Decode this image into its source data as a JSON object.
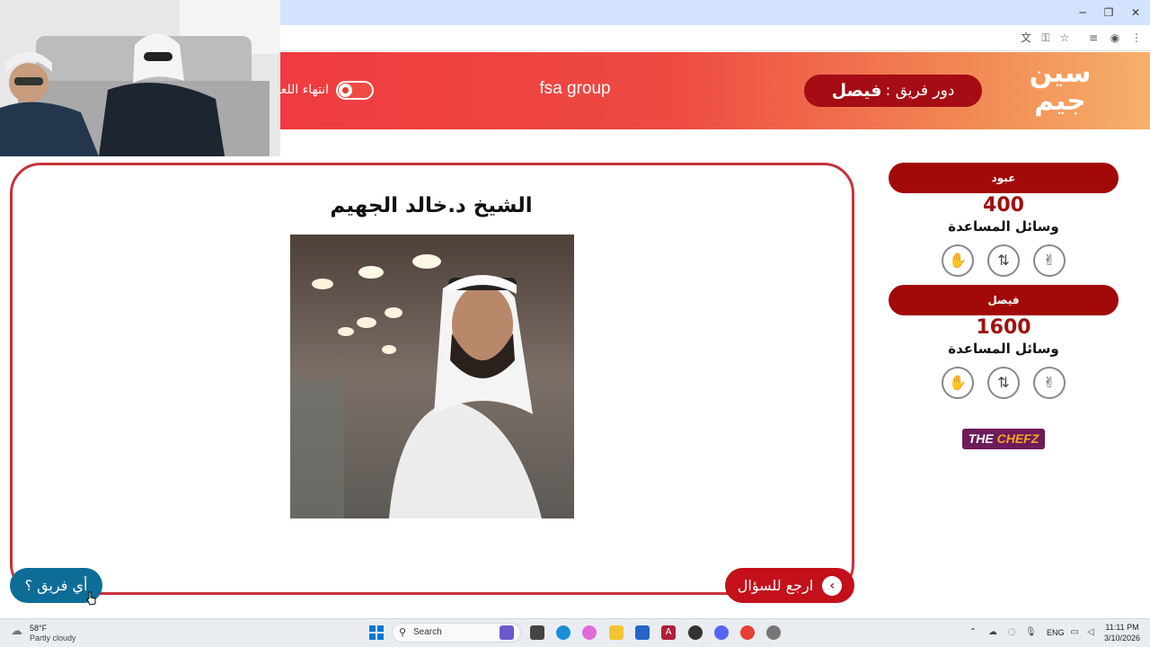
{
  "header": {
    "team_name": "fsa group",
    "turn_label": "دور فريق :",
    "turn_team": "فيصل",
    "end_label": "انتهاء اللعبة",
    "logo_line1": "سين",
    "logo_line2": "جيم"
  },
  "answer": {
    "title": "الشيخ د.خالد الجهيم"
  },
  "buttons": {
    "back": "ارجع للسؤال",
    "which_team": "أي فريق ؟"
  },
  "teams": [
    {
      "name": "عبود",
      "score": "400",
      "aids_label": "وسائل المساعدة"
    },
    {
      "name": "فيصل",
      "score": "1600",
      "aids_label": "وسائل المساعدة"
    }
  ],
  "aids_icons": [
    "hand-icon",
    "swap-icon",
    "peace-sign-icon"
  ],
  "sponsor": {
    "prefix": "THE ",
    "name": "CHEFZ"
  },
  "taskbar": {
    "weather_temp": "58°F",
    "weather_desc": "Partly cloudy",
    "search_label": "Search",
    "lang": "ENG",
    "time": "11:11 PM",
    "date": "3/10/2026"
  },
  "colors": {
    "accent_red": "#c3101b",
    "team_pill": "#a20a0a",
    "blue_button": "#0d6d96",
    "banner_start": "#ef3b3f",
    "banner_end": "#f6b06a"
  }
}
